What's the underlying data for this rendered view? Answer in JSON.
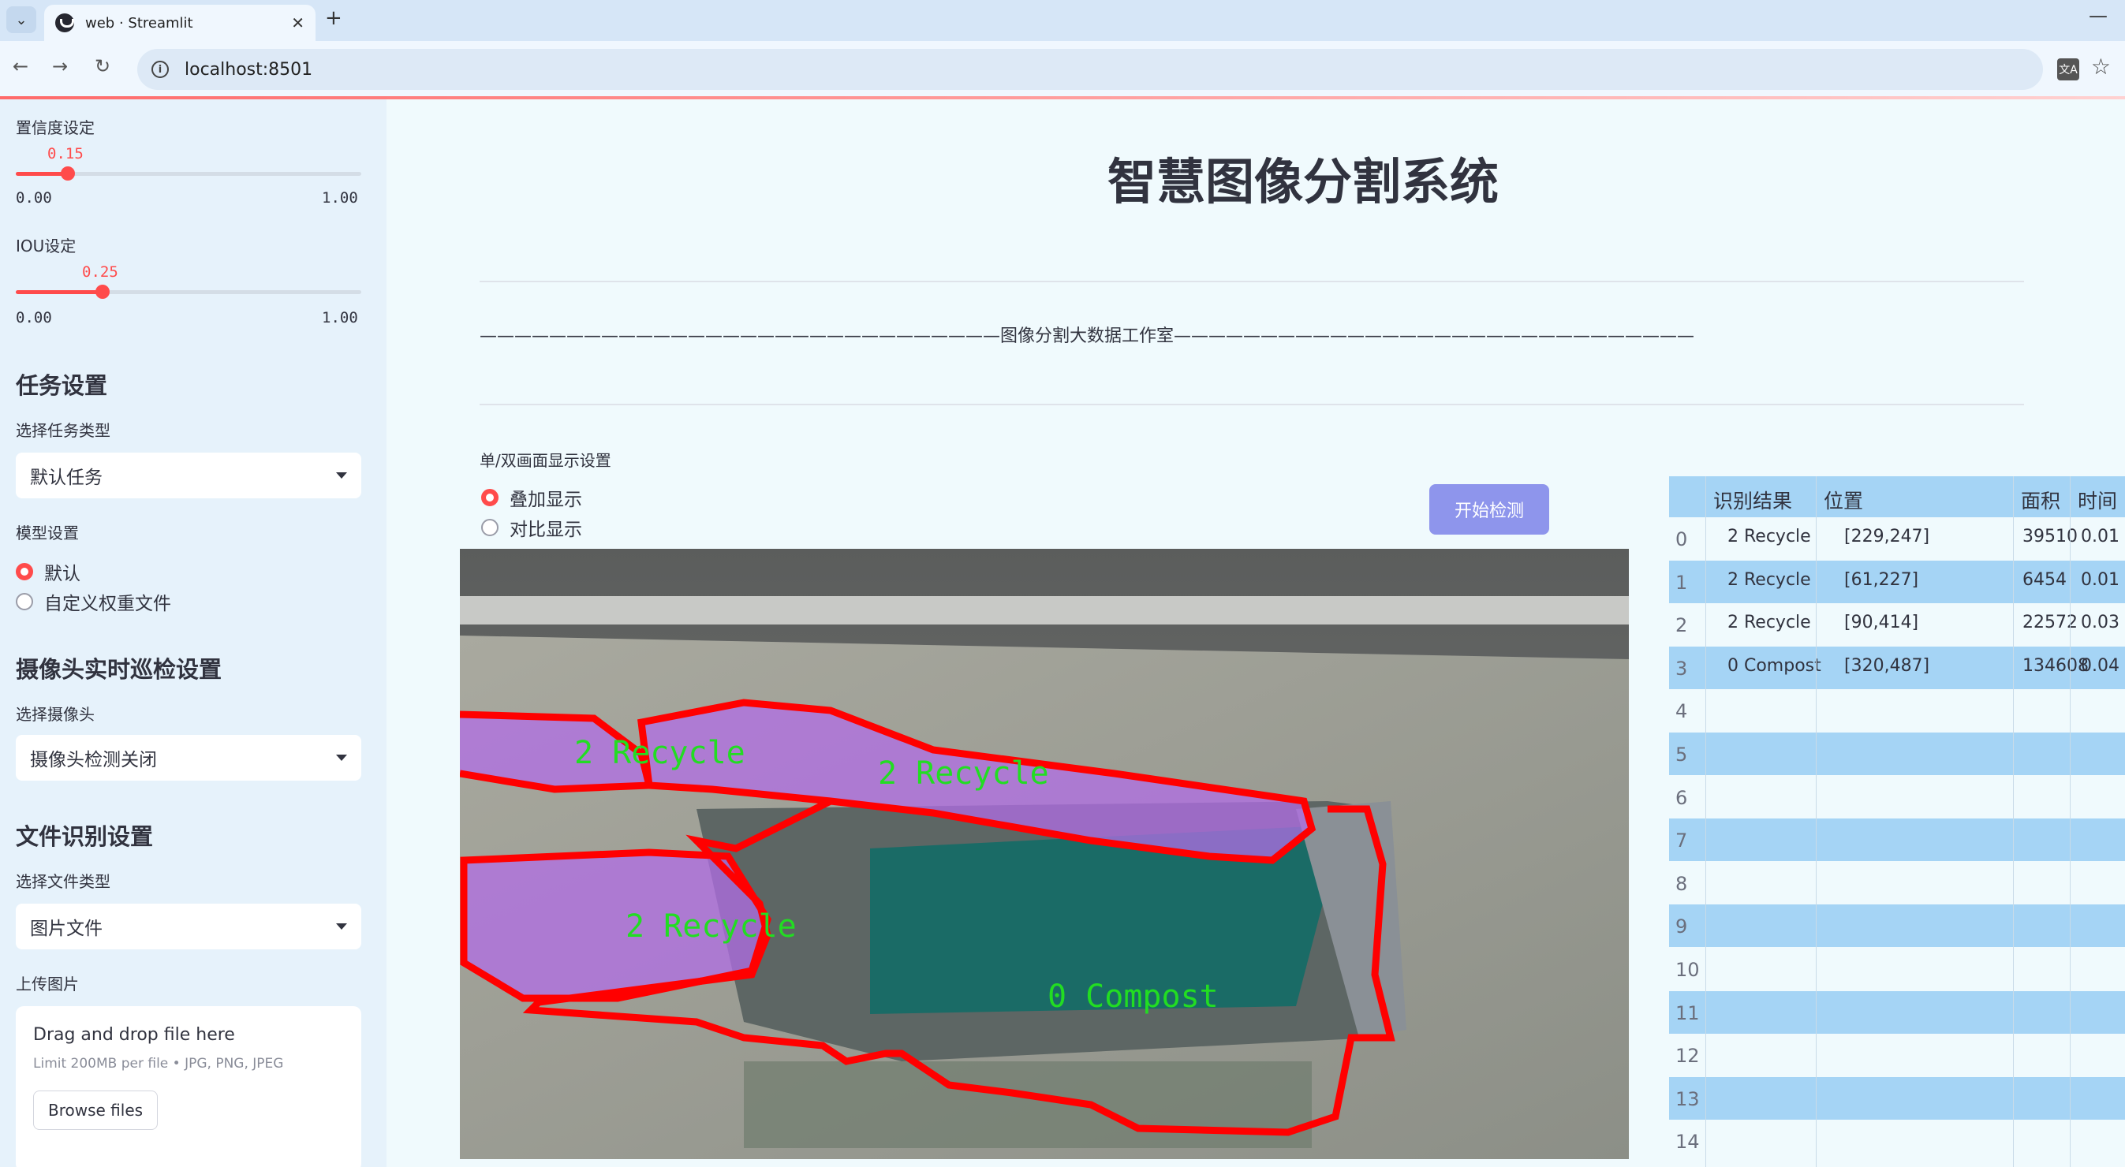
{
  "browser": {
    "tab_title": "web · Streamlit",
    "url": "localhost:8501"
  },
  "sidebar": {
    "confidence_label": "置信度设定",
    "confidence_value": "0.15",
    "confidence": 0.15,
    "iou_label": "IOU设定",
    "iou_value": "0.25",
    "iou": 0.25,
    "slider_min": "0.00",
    "slider_max": "1.00",
    "task_header": "任务设置",
    "task_type_label": "选择任务类型",
    "task_type_value": "默认任务",
    "model_label": "模型设置",
    "model_options": [
      "默认",
      "自定义权重文件"
    ],
    "camera_header": "摄像头实时巡检设置",
    "camera_label": "选择摄像头",
    "camera_value": "摄像头检测关闭",
    "file_header": "文件识别设置",
    "file_type_label": "选择文件类型",
    "file_type_value": "图片文件",
    "upload_label": "上传图片",
    "upload_title": "Drag and drop file here",
    "upload_limit": "Limit 200MB per file • JPG, PNG, JPEG",
    "browse_label": "Browse files"
  },
  "main": {
    "title": "智慧图像分割系统",
    "subtitle": "——————————————————————————————图像分割大数据工作室——————————————————————————————",
    "display_label": "单/双画面显示设置",
    "display_options": [
      "叠加显示",
      "对比显示"
    ],
    "start_button": "开始检测"
  },
  "detections": [
    {
      "label": "2 Recycle"
    },
    {
      "label": "2 Recycle"
    },
    {
      "label": "2 Recycle"
    },
    {
      "label": "0 Compost"
    }
  ],
  "table": {
    "headers": [
      "识别结果",
      "位置",
      "面积",
      "时间"
    ],
    "rows": [
      {
        "idx": "0",
        "result": "2 Recycle",
        "pos": "[229,247]",
        "area": "39510",
        "time": "0.01"
      },
      {
        "idx": "1",
        "result": "2 Recycle",
        "pos": "[61,227]",
        "area": "6454",
        "time": "0.01"
      },
      {
        "idx": "2",
        "result": "2 Recycle",
        "pos": "[90,414]",
        "area": "22572",
        "time": "0.03"
      },
      {
        "idx": "3",
        "result": "0 Compost",
        "pos": "[320,487]",
        "area": "134608",
        "time": "0.04"
      },
      {
        "idx": "4",
        "result": "",
        "pos": "",
        "area": "",
        "time": ""
      },
      {
        "idx": "5",
        "result": "",
        "pos": "",
        "area": "",
        "time": ""
      },
      {
        "idx": "6",
        "result": "",
        "pos": "",
        "area": "",
        "time": ""
      },
      {
        "idx": "7",
        "result": "",
        "pos": "",
        "area": "",
        "time": ""
      },
      {
        "idx": "8",
        "result": "",
        "pos": "",
        "area": "",
        "time": ""
      },
      {
        "idx": "9",
        "result": "",
        "pos": "",
        "area": "",
        "time": ""
      },
      {
        "idx": "10",
        "result": "",
        "pos": "",
        "area": "",
        "time": ""
      },
      {
        "idx": "11",
        "result": "",
        "pos": "",
        "area": "",
        "time": ""
      },
      {
        "idx": "12",
        "result": "",
        "pos": "",
        "area": "",
        "time": ""
      },
      {
        "idx": "13",
        "result": "",
        "pos": "",
        "area": "",
        "time": ""
      },
      {
        "idx": "14",
        "result": "",
        "pos": "",
        "area": "",
        "time": ""
      }
    ]
  },
  "colors": {
    "accent": "#ff4b4b",
    "table_stripe": "#a5d4f5",
    "mask": "#b26ee6",
    "contour": "#ff0000",
    "label_text": "#22dd22"
  }
}
